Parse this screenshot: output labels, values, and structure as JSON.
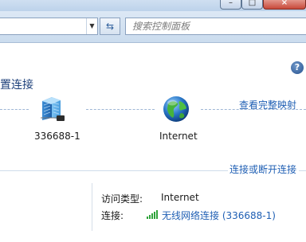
{
  "toolbar": {
    "search_placeholder": "搜索控制面板"
  },
  "page": {
    "title": "置连接",
    "help": "?",
    "full_map_link": "查看完整映射",
    "connect_link": "连接或断开连接"
  },
  "map": {
    "network_name": "336688-1",
    "internet_label": "Internet"
  },
  "details": {
    "access_type_label": "访问类型:",
    "access_type_value": "Internet",
    "connection_label": "连接:",
    "connection_value": "无线网络连接 (336688-1)"
  },
  "icons": {
    "refresh": "refresh-icon",
    "network": "network-icon",
    "globe": "globe-icon",
    "wifi": "wifi-signal-icon",
    "help": "help-icon"
  },
  "colors": {
    "link": "#1f5fb4",
    "title": "#1c3f7a",
    "chrome": "#cbdcee"
  }
}
